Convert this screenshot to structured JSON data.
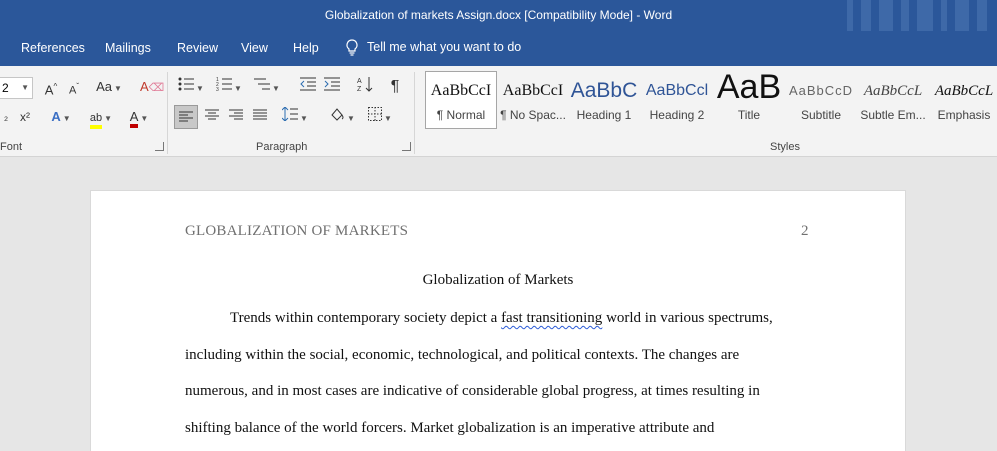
{
  "titlebar": {
    "title": "Globalization of markets Assign.docx [Compatibility Mode]  -  Word"
  },
  "tabs": [
    "References",
    "Mailings",
    "Review",
    "View",
    "Help"
  ],
  "tell_me": "Tell me what you want to do",
  "font_group": {
    "font_size": "2",
    "label": "Font"
  },
  "paragraph_group": {
    "label": "Paragraph"
  },
  "styles_group": {
    "label": "Styles",
    "items": [
      {
        "sample": "AaBbCcI",
        "name": "¶ Normal"
      },
      {
        "sample": "AaBbCcI",
        "name": "¶ No Spac..."
      },
      {
        "sample": "AaBbC",
        "name": "Heading 1"
      },
      {
        "sample": "AaBbCcl",
        "name": "Heading 2"
      },
      {
        "sample": "AaB",
        "name": "Title"
      },
      {
        "sample": "AaBbCcD",
        "name": "Subtitle"
      },
      {
        "sample": "AaBbCcL",
        "name": "Subtle Em..."
      },
      {
        "sample": "AaBbCcL",
        "name": "Emphasis"
      }
    ]
  },
  "colors": {
    "word_blue": "#2b579a",
    "highlight": "#ffff00",
    "font_color": "#c00000"
  },
  "document": {
    "running_head": "GLOBALIZATION OF MARKETS",
    "page_number": "2",
    "title": "Globalization of Markets",
    "line1_a": "Trends within contemporary society depict a ",
    "line1_b": "fast transitioning",
    "line1_c": " world in various spectrums,",
    "line2": "including within the social, economic, technological, and political contexts. The changes are",
    "line3": "numerous, and in most cases are indicative of considerable global progress, at times resulting in",
    "line4": "shifting balance of the world forcers. Market globalization is an imperative attribute and"
  }
}
